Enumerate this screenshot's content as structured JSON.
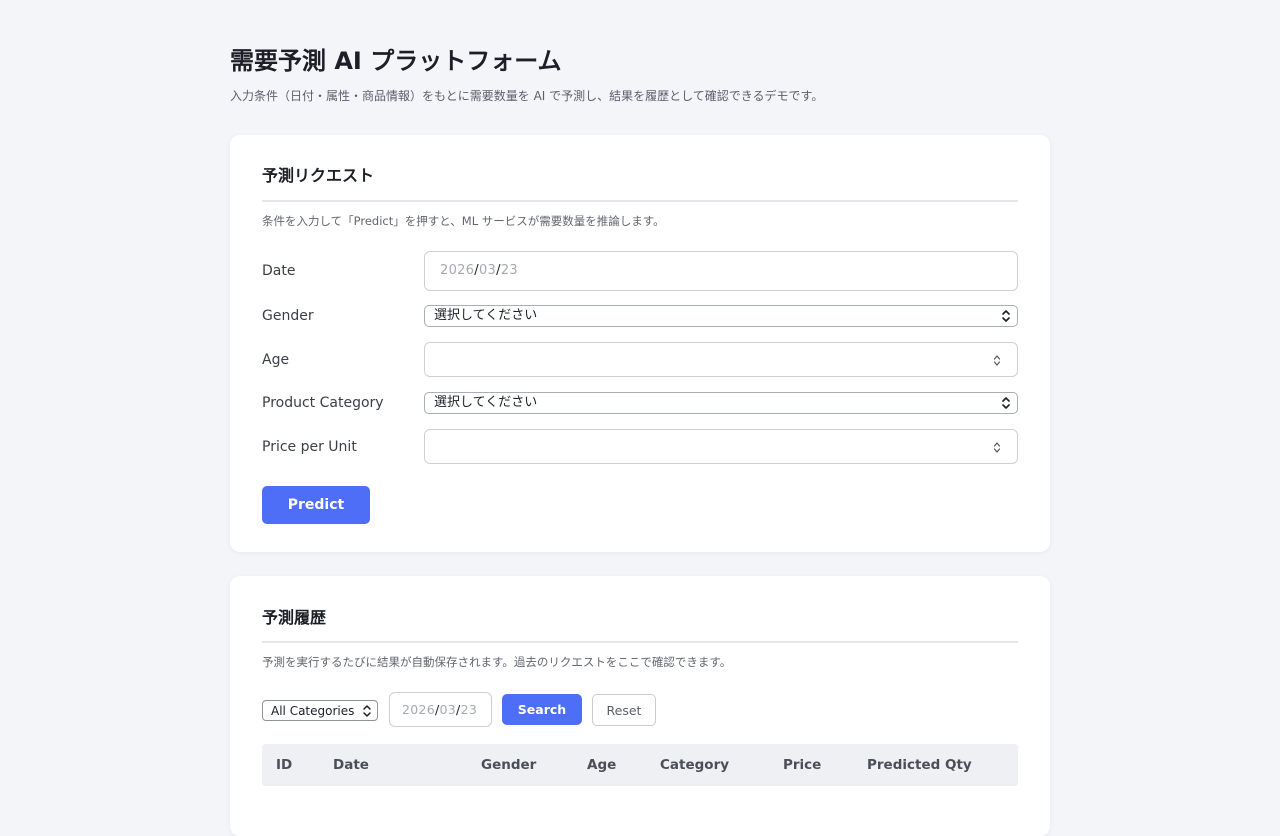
{
  "header": {
    "title": "需要予測 AI プラットフォーム",
    "subtitle": "入力条件（日付・属性・商品情報）をもとに需要数量を AI で予測し、結果を履歴として確認できるデモです。"
  },
  "request_card": {
    "title": "予測リクエスト",
    "description": "条件を入力して「Predict」を押すと、ML サービスが需要数量を推論します。",
    "fields": {
      "date": {
        "label": "Date",
        "year": "2026",
        "month": "03",
        "day": "23",
        "separator": "/"
      },
      "gender": {
        "label": "Gender",
        "selected": "選択してください"
      },
      "age": {
        "label": "Age",
        "value": ""
      },
      "product_category": {
        "label": "Product Category",
        "selected": "選択してください"
      },
      "price_per_unit": {
        "label": "Price per Unit",
        "value": ""
      }
    },
    "predict_label": "Predict"
  },
  "history_card": {
    "title": "予測履歴",
    "description": "予測を実行するたびに結果が自動保存されます。過去のリクエストをここで確認できます。",
    "filters": {
      "category_selected": "All Categories",
      "date": {
        "year": "2026",
        "month": "03",
        "day": "23",
        "separator": "/"
      },
      "search_label": "Search",
      "reset_label": "Reset"
    },
    "table": {
      "columns": [
        "ID",
        "Date",
        "Gender",
        "Age",
        "Category",
        "Price",
        "Predicted Qty"
      ]
    }
  },
  "icons": {
    "select_arrow": "chevron-up-down-icon",
    "number_spinner": "spinner-arrows-icon"
  },
  "colors": {
    "accent": "#4f6ef7",
    "background": "#f4f5f9",
    "card": "#ffffff",
    "table_header": "#eff0f4"
  }
}
